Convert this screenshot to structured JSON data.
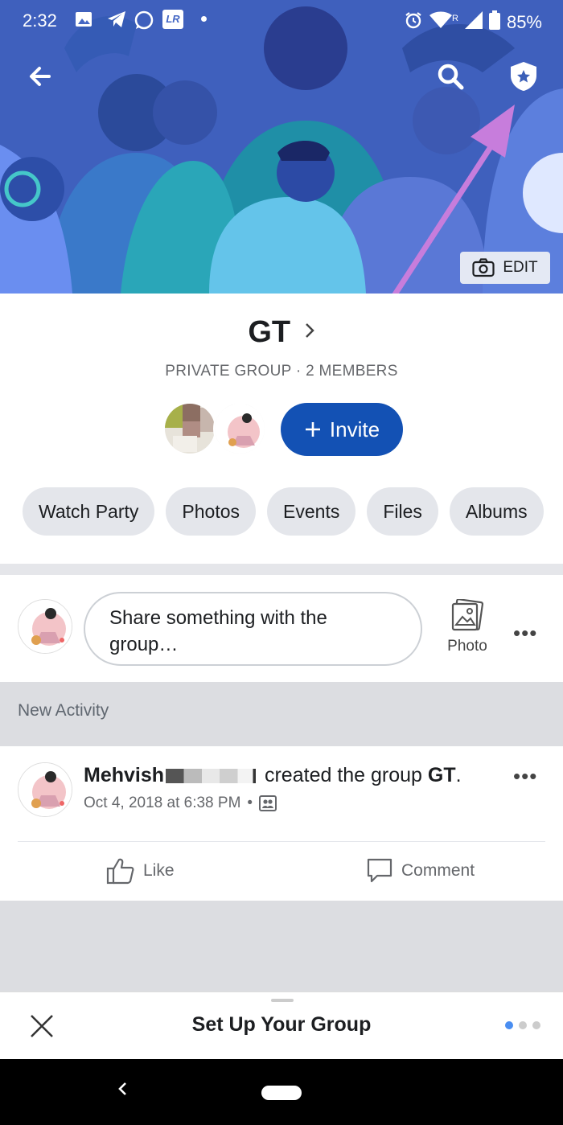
{
  "status_bar": {
    "time": "2:32",
    "battery": "85%",
    "signal_badge": "R",
    "notif_badge": "LR"
  },
  "cover": {
    "edit_label": "EDIT",
    "icons": [
      "back-arrow-icon",
      "search-icon",
      "shield-star-icon",
      "camera-icon"
    ]
  },
  "group": {
    "name": "GT",
    "meta": "PRIVATE GROUP · 2 MEMBERS",
    "invite_label": "Invite"
  },
  "chips": [
    "Watch Party",
    "Photos",
    "Events",
    "Files",
    "Albums"
  ],
  "composer": {
    "text": "Share something with the group…",
    "photo_label": "Photo"
  },
  "activity": {
    "heading": "New Activity"
  },
  "post": {
    "author": "Mehvish",
    "action_text": "created the group",
    "group_name": "GT",
    "period": ".",
    "timestamp": "Oct 4, 2018 at 6:38 PM",
    "separator": "•",
    "like_label": "Like",
    "comment_label": "Comment"
  },
  "sheet": {
    "title": "Set Up Your Group",
    "page_indicator": {
      "total": 3,
      "active": 1
    }
  },
  "colors": {
    "accent": "#1351b4",
    "annotation_arrow": "#c77ddc",
    "chip_bg": "#e4e6eb",
    "divider_band": "#dcdde1"
  }
}
